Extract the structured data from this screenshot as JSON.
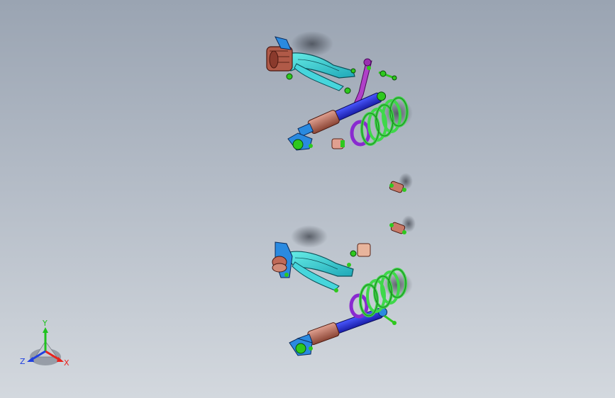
{
  "triad": {
    "labels": {
      "x": "X",
      "y": "Y",
      "z": "Z"
    },
    "colors": {
      "x": "#e8241e",
      "y": "#1fc21f",
      "z": "#2040e0"
    }
  },
  "colors": {
    "coil_spring": "#3fd84a",
    "damper_body": "#c06a58",
    "damper_rod": "#2830d8",
    "control_arm": "#38d8d0",
    "bushing": "#b05a48",
    "spring_seat": "#8a2ad0",
    "link": "#9a30b0",
    "fastener": "#2ec81e",
    "mount": "#2a8ae0"
  }
}
